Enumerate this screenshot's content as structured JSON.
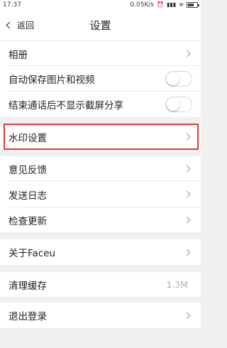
{
  "status_bar": {
    "time": "17:37",
    "network_speed": "0.05K/s",
    "icons": [
      "clock-icon",
      "signal-icon",
      "wifi-icon",
      "battery-icon"
    ]
  },
  "navbar": {
    "back_label": "返回",
    "title": "设置"
  },
  "rows": {
    "album": {
      "label": "相册"
    },
    "auto_save": {
      "label": "自动保存图片和视频",
      "on": false
    },
    "end_call": {
      "label": "结束通话后不显示截屏分享",
      "on": false
    },
    "watermark": {
      "label": "水印设置"
    },
    "feedback": {
      "label": "意见反馈"
    },
    "send_log": {
      "label": "发送日志"
    },
    "check_update": {
      "label": "检查更新"
    },
    "about": {
      "label": "关于Faceu"
    },
    "clear_cache": {
      "label": "清理缓存",
      "value": "1.3M"
    },
    "logout": {
      "label": "退出登录"
    }
  },
  "colors": {
    "highlight_border": "#e03a3a",
    "background": "#f0f0f0",
    "chevron": "#9a9a9a"
  }
}
